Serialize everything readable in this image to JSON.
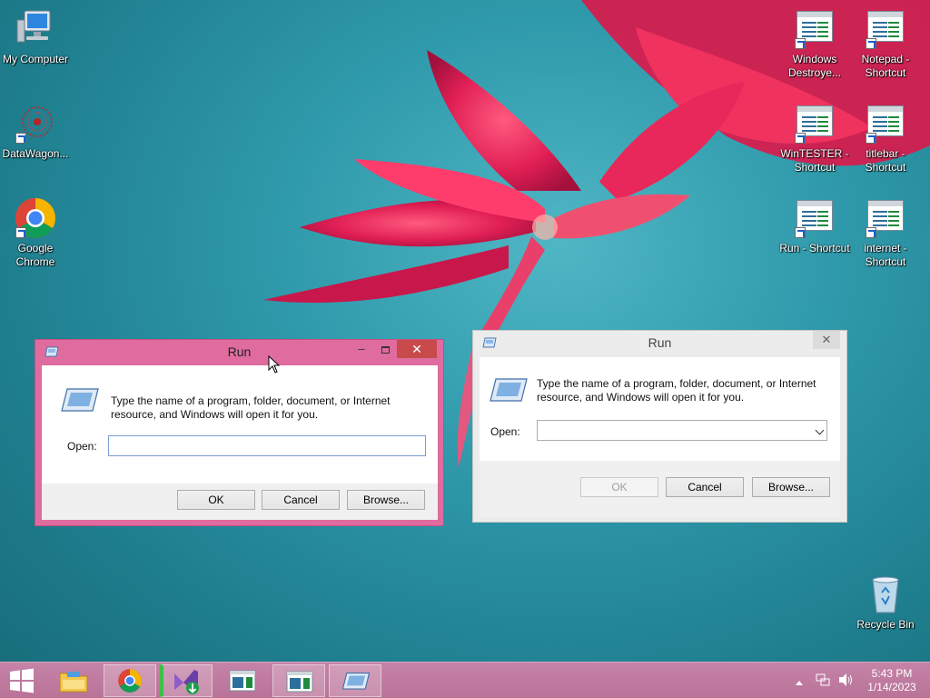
{
  "desktop": {
    "icons_left": [
      {
        "label": "My Computer"
      },
      {
        "label": "DataWagon..."
      },
      {
        "label": "Google Chrome"
      }
    ],
    "icons_right": [
      {
        "label": "Windows Destroye..."
      },
      {
        "label": "Notepad - Shortcut"
      },
      {
        "label": "WinTESTER - Shortcut"
      },
      {
        "label": "titlebar - Shortcut"
      },
      {
        "label": "Run - Shortcut"
      },
      {
        "label": "internet - Shortcut"
      }
    ],
    "recycle_bin": {
      "label": "Recycle Bin"
    }
  },
  "run_dialog_active": {
    "title": "Run",
    "prompt": "Type the name of a program, folder, document, or Internet resource, and Windows will open it for you.",
    "open_label": "Open:",
    "open_value": "",
    "ok_label": "OK",
    "cancel_label": "Cancel",
    "browse_label": "Browse...",
    "frame_color": "#e06b9e"
  },
  "run_dialog_inactive": {
    "title": "Run",
    "prompt": "Type the name of a program, folder, document, or Internet resource, and Windows will open it for you.",
    "open_label": "Open:",
    "open_value": "",
    "ok_label": "OK",
    "cancel_label": "Cancel",
    "browse_label": "Browse...",
    "ok_disabled": true
  },
  "taskbar": {
    "color": "#bf7ba0",
    "items": [
      {
        "name": "start-button",
        "icon": "windows-logo-icon"
      },
      {
        "name": "file-explorer",
        "icon": "folder-icon"
      },
      {
        "name": "google-chrome",
        "icon": "chrome-icon"
      },
      {
        "name": "visual-studio",
        "icon": "visual-studio-icon"
      },
      {
        "name": "app-window-1",
        "icon": "app-window-icon"
      },
      {
        "name": "app-window-2",
        "icon": "app-window-icon"
      },
      {
        "name": "run-dialog",
        "icon": "run-icon"
      }
    ],
    "clock_time": "5:43 PM",
    "clock_date": "1/14/2023"
  }
}
